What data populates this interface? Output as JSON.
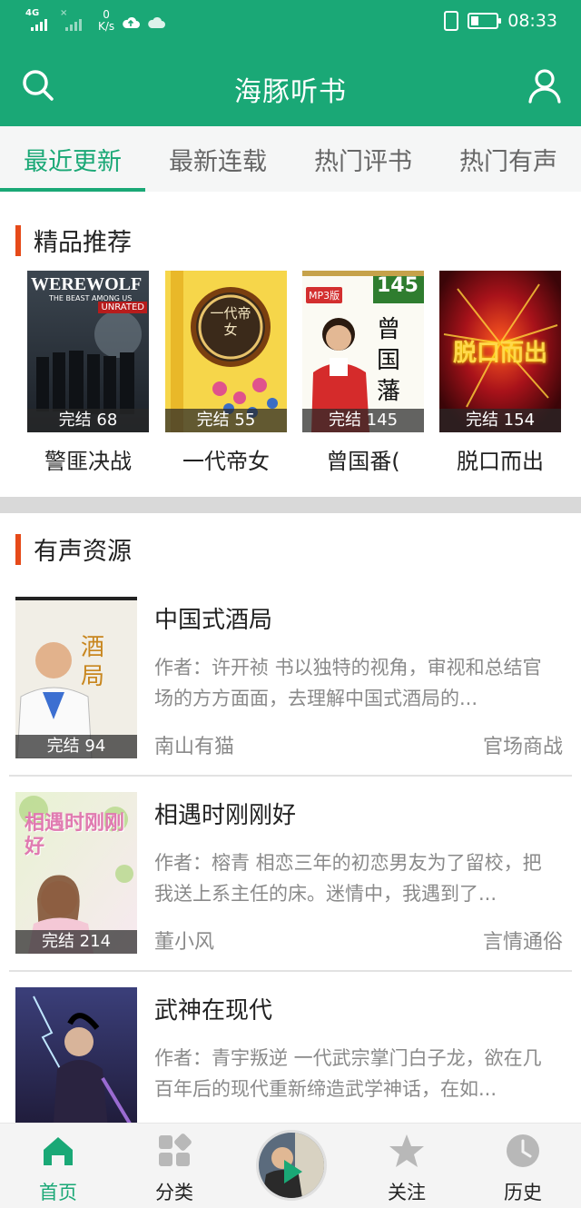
{
  "status_bar": {
    "network": "4G",
    "speed_value": "0",
    "speed_unit": "K/s",
    "time": "08:33",
    "battery_level": 0.3
  },
  "app_bar": {
    "title": "海豚听书",
    "left_icon": "search-icon",
    "right_icon": "user-icon"
  },
  "tabs": [
    {
      "label": "最近更新",
      "active": true
    },
    {
      "label": "最新连载",
      "active": false
    },
    {
      "label": "热门评书",
      "active": false
    },
    {
      "label": "热门有声",
      "active": false
    }
  ],
  "featured": {
    "heading": "精品推荐",
    "items": [
      {
        "title": "警匪决战",
        "badge": "完结 68",
        "cover_text": "WEREWOLF",
        "cover_sub": "THE BEAST AMONG US",
        "cover_tag": "UNRATED"
      },
      {
        "title": "一代帝女",
        "badge": "完结 55",
        "cover_text": "一代帝女"
      },
      {
        "title": "曾国番(",
        "badge": "完结 145",
        "cover_text": "曾国藩",
        "cover_num": "145",
        "cover_tag": "MP3版"
      },
      {
        "title": "脱口而出",
        "badge": "完结 154",
        "cover_text": "脱口而出"
      }
    ]
  },
  "audio": {
    "heading": "有声资源",
    "items": [
      {
        "title": "中国式酒局",
        "desc": "作者：许开祯 书以独特的视角，审视和总结官场的方方面面，去理解中国式酒局的...",
        "author": "南山有猫",
        "genre": "官场商战",
        "badge": "完结 94",
        "cover_text": "酒局"
      },
      {
        "title": "相遇时刚刚好",
        "desc": "作者：榕青 相恋三年的初恋男友为了留校，把我送上系主任的床。迷情中，我遇到了...",
        "author": "董小风",
        "genre": "言情通俗",
        "badge": "完结 214",
        "cover_text": "相遇时刚刚好"
      },
      {
        "title": "武神在现代",
        "desc": "作者：青宇叛逆 一代武宗掌门白子龙，欲在几百年后的现代重新缔造武学神话，在如...",
        "author": "",
        "genre": "",
        "badge": "",
        "cover_text": ""
      }
    ]
  },
  "bottom_nav": [
    {
      "label": "首页",
      "icon": "home-icon",
      "active": true
    },
    {
      "label": "分类",
      "icon": "category-icon",
      "active": false
    },
    {
      "label": "关注",
      "icon": "star-icon",
      "active": false
    },
    {
      "label": "历史",
      "icon": "clock-icon",
      "active": false
    }
  ],
  "colors": {
    "brand": "#1aa876",
    "accent_bar": "#e64a19"
  }
}
